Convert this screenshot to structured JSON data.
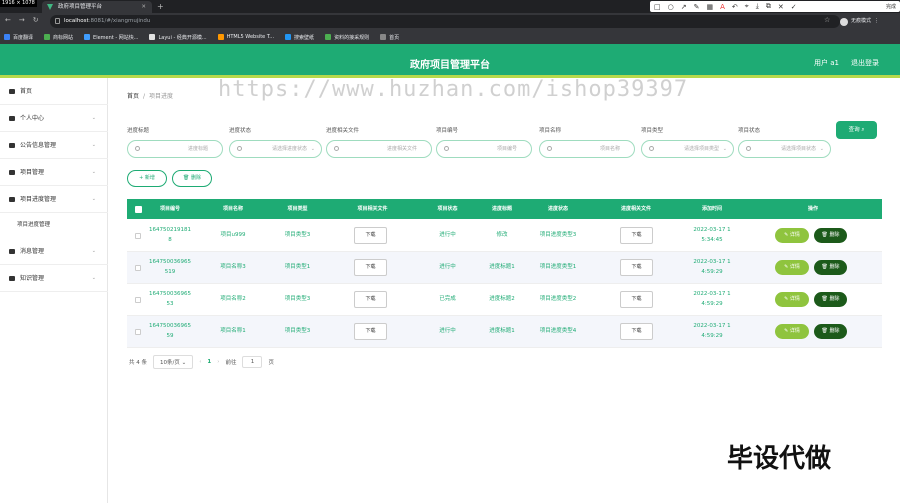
{
  "browser": {
    "resolution_label": "1916 × 1078",
    "tab_title": "政府项目管理平台",
    "url_host": "localhost",
    "url_path": ":8081/#/xiangmujindu",
    "profile_label": "无痕模式",
    "capture_done": "完成",
    "bookmarks": [
      "百度翻译",
      "商标网站",
      "Element - 网站快...",
      "Layui - 经典开源模...",
      "HTML5 Website T...",
      "搜索壁纸",
      "资料的接采规则",
      "首页"
    ],
    "bookmark_colors": [
      "#3b82f6",
      "#4caf50",
      "#409eff",
      "#e2e2e2",
      "#ff9800",
      "#2196f3",
      "#4caf50",
      "#888888"
    ]
  },
  "header": {
    "title": "政府项目管理平台",
    "user": "用户 a1",
    "logout": "退出登录",
    "accent": "#1eab74",
    "stripe": "#b6d94b"
  },
  "sidebar": {
    "items": [
      {
        "label": "首页",
        "icon": "home-icon"
      },
      {
        "label": "个人中心",
        "icon": "user-icon"
      },
      {
        "label": "公告信息管理",
        "icon": "notice-icon"
      },
      {
        "label": "项目管理",
        "icon": "project-icon"
      },
      {
        "label": "项目进度管理",
        "icon": "progress-icon"
      },
      {
        "label": "项目进度管理",
        "icon": ""
      },
      {
        "label": "消息管理",
        "icon": "message-icon"
      },
      {
        "label": "知识管理",
        "icon": "knowledge-icon"
      }
    ]
  },
  "breadcrumb": {
    "home": "首页",
    "separator": "/",
    "current": "项目进度"
  },
  "watermark": "https://www.huzhan.com/ishop39397",
  "filters": [
    {
      "label": "进度标题",
      "placeholder": "进度标题"
    },
    {
      "label": "进度状态",
      "placeholder": "请选择进度状态"
    },
    {
      "label": "进度相关文件",
      "placeholder": "进度相关文件"
    },
    {
      "label": "项目编号",
      "placeholder": "项目编号"
    },
    {
      "label": "项目名称",
      "placeholder": "项目名称"
    },
    {
      "label": "项目类型",
      "placeholder": "请选择项目类型"
    },
    {
      "label": "项目状态",
      "placeholder": "请选择项目状态"
    }
  ],
  "query_button": "查询",
  "actions": {
    "add": "+ 新增",
    "delete": "删除"
  },
  "table": {
    "headers": [
      "项目编号",
      "项目名称",
      "项目类型",
      "项目相关文件",
      "项目状态",
      "进度标题",
      "进度状态",
      "进度相关文件",
      "添加时间",
      "操作"
    ],
    "download_label": "下载",
    "detail_label": "详情",
    "delete_label": "删除",
    "rows": [
      {
        "no1": "164750219181",
        "no2": "8",
        "name": "项目u999",
        "type": "项目类型3",
        "status": "进行中",
        "title": "修改",
        "pstatus": "项目进度类型3",
        "time1": "2022-03-17 1",
        "time2": "5:34:45"
      },
      {
        "no1": "164750036965",
        "no2": "519",
        "name": "项目名称3",
        "type": "项目类型1",
        "status": "进行中",
        "title": "进度标题1",
        "pstatus": "项目进度类型1",
        "time1": "2022-03-17 1",
        "time2": "4:59:29"
      },
      {
        "no1": "164750036965",
        "no2": "53",
        "name": "项目名称2",
        "type": "项目类型3",
        "status": "已完成",
        "title": "进度标题2",
        "pstatus": "项目进度类型2",
        "time1": "2022-03-17 1",
        "time2": "4:59:29"
      },
      {
        "no1": "164750036965",
        "no2": "59",
        "name": "项目名称1",
        "type": "项目类型3",
        "status": "进行中",
        "title": "进度标题1",
        "pstatus": "项目进度类型4",
        "time1": "2022-03-17 1",
        "time2": "4:59:29"
      }
    ]
  },
  "pager": {
    "total": "共 4 条",
    "page_size": "10条/页",
    "current": "1",
    "goto": "前往",
    "goto_value": "1",
    "page_unit": "页"
  },
  "overlay_text": "毕设代做"
}
